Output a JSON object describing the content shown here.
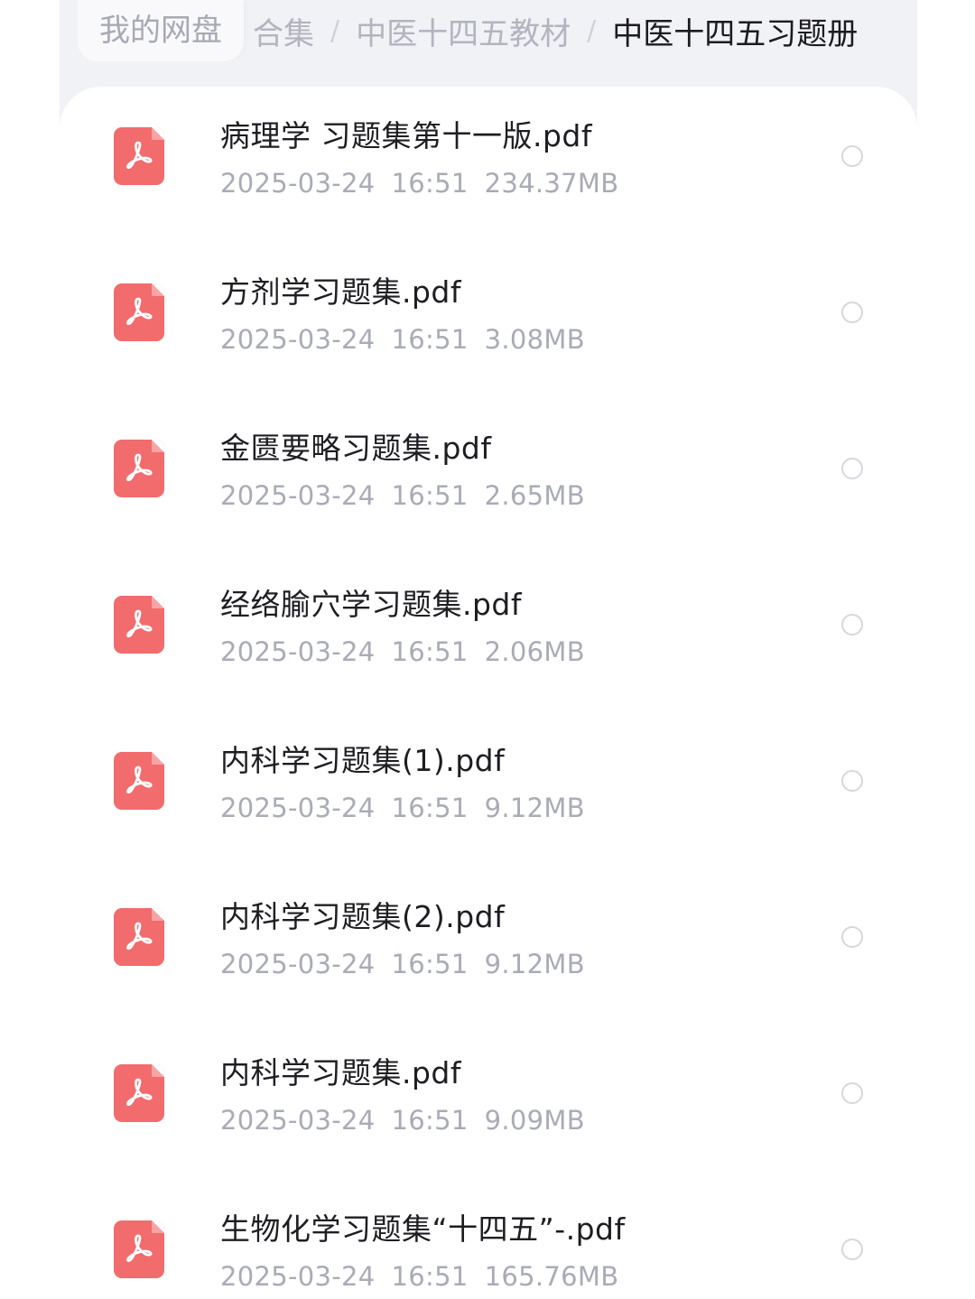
{
  "breadcrumb": {
    "root": "我的网盘",
    "partial": "合集",
    "parent": "中医十四五教材",
    "current": "中医十四五习题册",
    "separator": "/"
  },
  "files": [
    {
      "name": "病理学 习题集第十一版.pdf",
      "date": "2025-03-24",
      "time": "16:51",
      "size": "234.37MB",
      "icon": "pdf-icon"
    },
    {
      "name": "方剂学习题集.pdf",
      "date": "2025-03-24",
      "time": "16:51",
      "size": "3.08MB",
      "icon": "pdf-icon"
    },
    {
      "name": "金匮要略习题集.pdf",
      "date": "2025-03-24",
      "time": "16:51",
      "size": "2.65MB",
      "icon": "pdf-icon"
    },
    {
      "name": "经络腧穴学习题集.pdf",
      "date": "2025-03-24",
      "time": "16:51",
      "size": "2.06MB",
      "icon": "pdf-icon"
    },
    {
      "name": "内科学习题集(1).pdf",
      "date": "2025-03-24",
      "time": "16:51",
      "size": "9.12MB",
      "icon": "pdf-icon"
    },
    {
      "name": "内科学习题集(2).pdf",
      "date": "2025-03-24",
      "time": "16:51",
      "size": "9.12MB",
      "icon": "pdf-icon"
    },
    {
      "name": "内科学习题集.pdf",
      "date": "2025-03-24",
      "time": "16:51",
      "size": "9.09MB",
      "icon": "pdf-icon"
    },
    {
      "name": "生物化学习题集“十四五”-.pdf",
      "date": "2025-03-24",
      "time": "16:51",
      "size": "165.76MB",
      "icon": "pdf-icon"
    }
  ],
  "colors": {
    "pdf_icon": "#f26b6d",
    "title_text": "#1d1d22",
    "meta_text": "#a9abb6",
    "radio_border": "#d6d7dc"
  }
}
